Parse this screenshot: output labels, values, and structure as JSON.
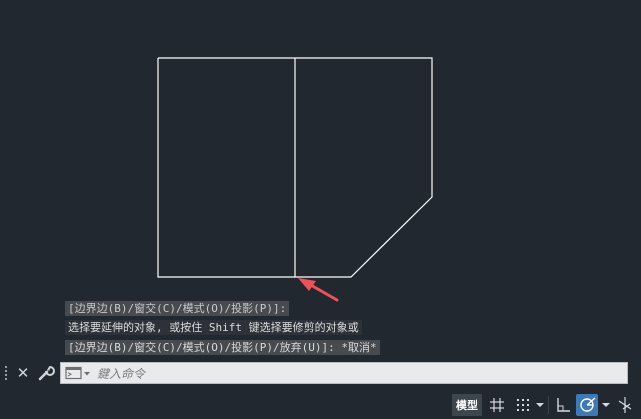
{
  "drawing": {
    "line_color": "#ffffff",
    "background": "#212830",
    "pointer_arrow_color": "#f0505a"
  },
  "command_history": [
    "[边界边(B)/窗交(C)/模式(O)/投影(P)]:",
    "选择要延伸的对象, 或按住 Shift 键选择要修剪的对象或",
    "[边界边(B)/窗交(C)/模式(O)/投影(P)/放弃(U)]: *取消*"
  ],
  "command_line": {
    "placeholder": "鍵入命令",
    "close_icon": "close-icon",
    "customize_icon": "wrench-icon",
    "recent_commands_icon": "command-prompt-icon"
  },
  "status_bar": {
    "model_label": "模型",
    "grid_icon": "grid-icon",
    "snap_icon": "snap-mode-icon",
    "ortho_icon": "ortho-icon",
    "polar_icon": "polar-tracking-icon",
    "isodraft_icon": "isodraft-icon",
    "active_color": "#3d79b8"
  }
}
